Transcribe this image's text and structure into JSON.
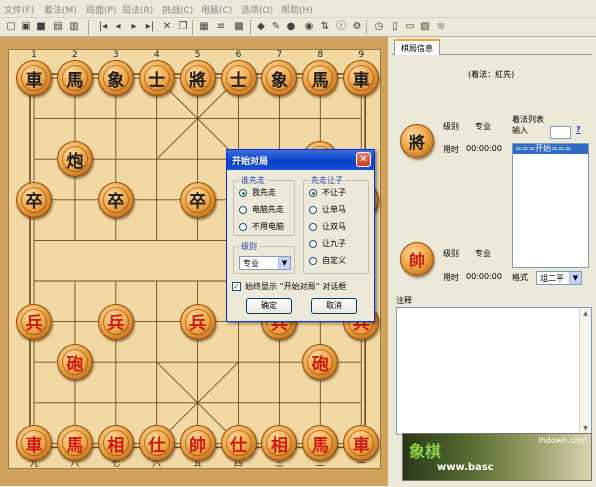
{
  "menu": [
    "文件(F)",
    "着法(M)",
    "局面(P)",
    "局法(R)",
    "挑战(C)",
    "电脑(C)",
    "选项(O)",
    "帮助(H)"
  ],
  "toolbar_icons": [
    "new-game-icon",
    "open-icon",
    "save-icon",
    "save-as-icon",
    "print-icon",
    "first-move-icon",
    "prev-move-icon",
    "next-move-icon",
    "last-move-icon",
    "undo-icon",
    "copy-icon",
    "board-icon",
    "moves-icon",
    "grid-icon",
    "palette-icon",
    "edit-icon",
    "record-icon",
    "color-icon",
    "flip-icon",
    "info-icon",
    "settings-icon",
    "clock-icon",
    "book-icon",
    "notes-icon",
    "image-icon",
    "close-icon"
  ],
  "board": {
    "files_top": [
      "1",
      "2",
      "3",
      "4",
      "5",
      "6",
      "7",
      "8",
      "9"
    ],
    "files_bottom": [
      "九",
      "八",
      "七",
      "六",
      "五",
      "四",
      "三",
      "二",
      "一"
    ],
    "pieces": [
      {
        "t": "車",
        "s": "black"
      },
      {
        "t": "馬",
        "s": "black"
      },
      {
        "t": "象",
        "s": "black"
      },
      {
        "t": "士",
        "s": "black"
      },
      {
        "t": "將",
        "s": "black"
      },
      {
        "t": "士",
        "s": "black"
      },
      {
        "t": "象",
        "s": "black"
      },
      {
        "t": "馬",
        "s": "black"
      },
      {
        "t": "車",
        "s": "black"
      },
      {
        "t": "炮",
        "s": "black"
      },
      {
        "t": "炮",
        "s": "black"
      },
      {
        "t": "卒",
        "s": "black"
      },
      {
        "t": "卒",
        "s": "black"
      },
      {
        "t": "卒",
        "s": "black"
      },
      {
        "t": "卒",
        "s": "black"
      },
      {
        "t": "卒",
        "s": "black"
      },
      {
        "t": "兵",
        "s": "red"
      },
      {
        "t": "兵",
        "s": "red"
      },
      {
        "t": "兵",
        "s": "red"
      },
      {
        "t": "兵",
        "s": "red"
      },
      {
        "t": "兵",
        "s": "red"
      },
      {
        "t": "砲",
        "s": "red"
      },
      {
        "t": "砲",
        "s": "red"
      },
      {
        "t": "車",
        "s": "red"
      },
      {
        "t": "馬",
        "s": "red"
      },
      {
        "t": "相",
        "s": "red"
      },
      {
        "t": "仕",
        "s": "red"
      },
      {
        "t": "帥",
        "s": "red"
      },
      {
        "t": "仕",
        "s": "red"
      },
      {
        "t": "相",
        "s": "red"
      },
      {
        "t": "馬",
        "s": "red"
      },
      {
        "t": "車",
        "s": "red"
      }
    ]
  },
  "dialog": {
    "title": "开始对局",
    "first_group": "谁先走",
    "first_options": [
      "我先走",
      "电脑先走",
      "不用电脑"
    ],
    "first_selected": 0,
    "handicap_group": "先走让子",
    "handicap_options": [
      "不让子",
      "让单马",
      "让双马",
      "让九子",
      "自定义"
    ],
    "handicap_selected": 0,
    "level_group": "级别",
    "level_value": "专业",
    "always_show": "始终显示 “开始对局” 对话框",
    "always_show_checked": true,
    "ok": "确定",
    "cancel": "取消"
  },
  "panel": {
    "tab": "棋局信息",
    "moves_info": "(着法：紅先)",
    "black_piece": "將",
    "red_piece": "帥",
    "level_label": "级别",
    "level_value": "专业",
    "time_label": "用时",
    "black_time": "00:00:00",
    "red_time": "00:00:00",
    "move_list_label": "着法列表",
    "input_label": "输入",
    "help": "?",
    "move_list_items": [
      "===开始==="
    ],
    "format_label": "格式",
    "format_value": "俎二平五",
    "notes_label": "注释"
  },
  "ad": {
    "logo": "象棋",
    "url": "www.basc",
    "mark": "ihdown.com"
  }
}
